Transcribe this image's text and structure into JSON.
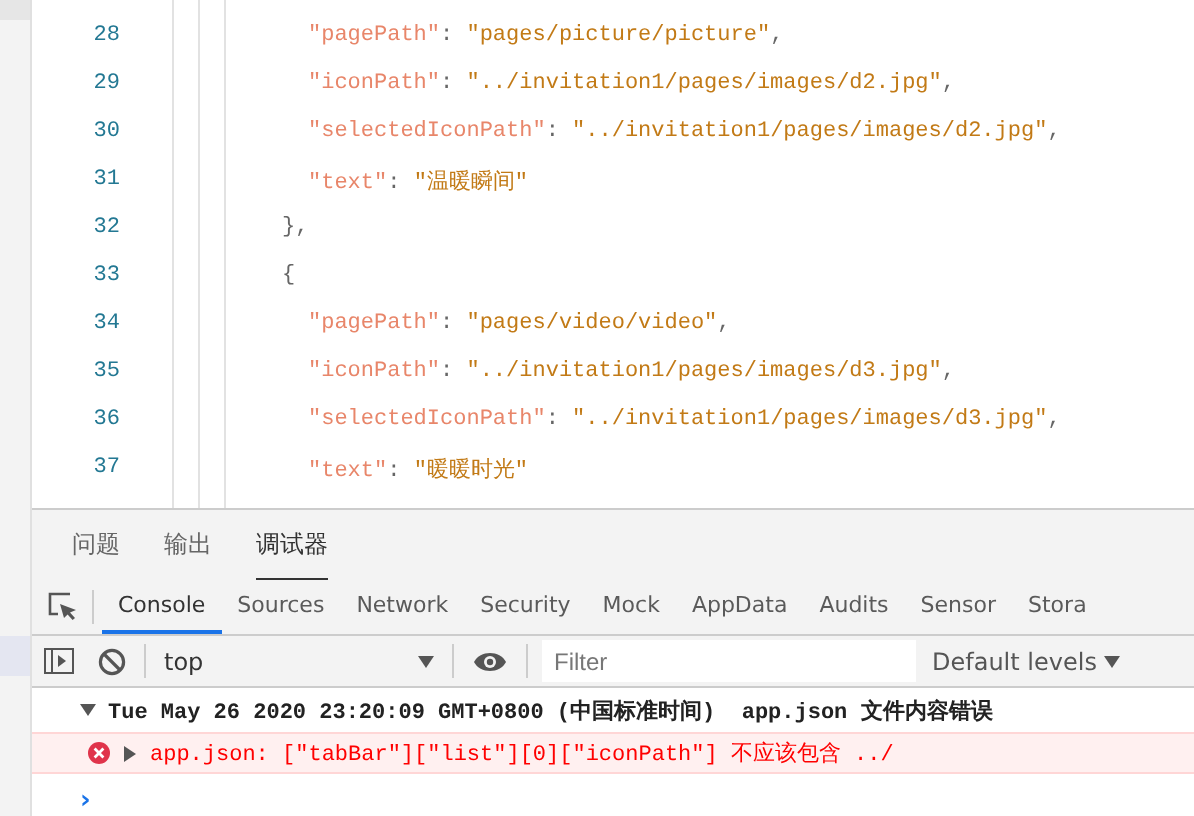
{
  "editor": {
    "lines": [
      {
        "number": "28",
        "kind": "pair",
        "key": "\"pagePath\"",
        "value": "\"pages/picture/picture\"",
        "trail": ","
      },
      {
        "number": "29",
        "kind": "pair",
        "key": "\"iconPath\"",
        "value": "\"../invitation1/pages/images/d2.jpg\"",
        "trail": ","
      },
      {
        "number": "30",
        "kind": "pair",
        "key": "\"selectedIconPath\"",
        "value": "\"../invitation1/pages/images/d2.jpg\"",
        "trail": ","
      },
      {
        "number": "31",
        "kind": "pair",
        "key": "\"text\"",
        "value": "\"温暖瞬间\""
      },
      {
        "number": "32",
        "kind": "brace",
        "text": "},"
      },
      {
        "number": "33",
        "kind": "brace",
        "text": "{"
      },
      {
        "number": "34",
        "kind": "pair",
        "key": "\"pagePath\"",
        "value": "\"pages/video/video\"",
        "trail": ","
      },
      {
        "number": "35",
        "kind": "pair",
        "key": "\"iconPath\"",
        "value": "\"../invitation1/pages/images/d3.jpg\"",
        "trail": ","
      },
      {
        "number": "36",
        "kind": "pair",
        "key": "\"selectedIconPath\"",
        "value": "\"../invitation1/pages/images/d3.jpg\"",
        "trail": ","
      },
      {
        "number": "37",
        "kind": "pair",
        "key": "\"text\"",
        "value": "\"暖暖时光\""
      }
    ],
    "separator": ":"
  },
  "panel_tabs": [
    {
      "label": "问题",
      "selected": false
    },
    {
      "label": "输出",
      "selected": false
    },
    {
      "label": "调试器",
      "selected": true
    }
  ],
  "devtools_tabs": [
    {
      "label": "Console",
      "selected": true
    },
    {
      "label": "Sources",
      "selected": false
    },
    {
      "label": "Network",
      "selected": false
    },
    {
      "label": "Security",
      "selected": false
    },
    {
      "label": "Mock",
      "selected": false
    },
    {
      "label": "AppData",
      "selected": false
    },
    {
      "label": "Audits",
      "selected": false
    },
    {
      "label": "Sensor",
      "selected": false
    },
    {
      "label": "Stora",
      "selected": false
    }
  ],
  "console_toolbar": {
    "context": "top",
    "filter_placeholder": "Filter",
    "levels": "Default levels"
  },
  "messages": [
    {
      "kind": "group",
      "expanded": true,
      "text": "Tue May 26 2020 23:20:09 GMT+0800 (中国标准时间)  app.json 文件内容错误"
    },
    {
      "kind": "error",
      "expanded": false,
      "text": "app.json: [\"tabBar\"][\"list\"][0][\"iconPath\"] 不应该包含 ../"
    }
  ],
  "prompt": "›"
}
